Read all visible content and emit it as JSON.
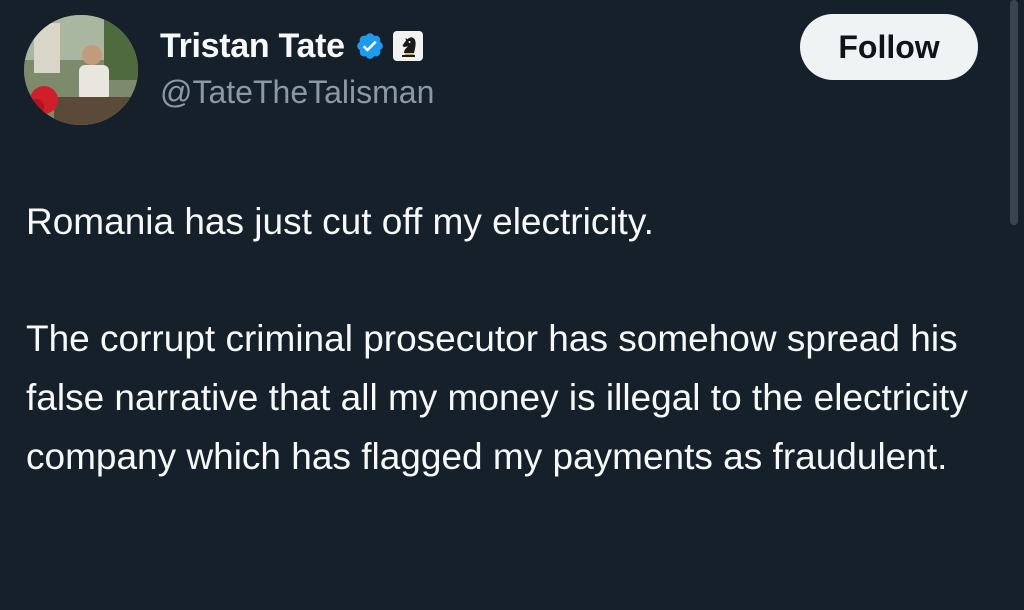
{
  "author": {
    "display_name": "Tristan Tate",
    "handle": "@TateTheTalisman",
    "verified": true,
    "verified_color": "#1d9bf0",
    "affiliate_badge": "chess-knight-icon"
  },
  "actions": {
    "follow_label": "Follow"
  },
  "tweet": {
    "paragraphs": [
      "Romania has just cut off my electricity.",
      "The corrupt criminal prosecutor has somehow spread his false narrative that all my money is illegal to the electricity company which has flagged my payments as fraudulent."
    ]
  },
  "theme": {
    "background": "#15202b",
    "text_primary": "#f7f9f9",
    "text_secondary": "#8b98a5",
    "button_bg": "#eff3f4"
  }
}
